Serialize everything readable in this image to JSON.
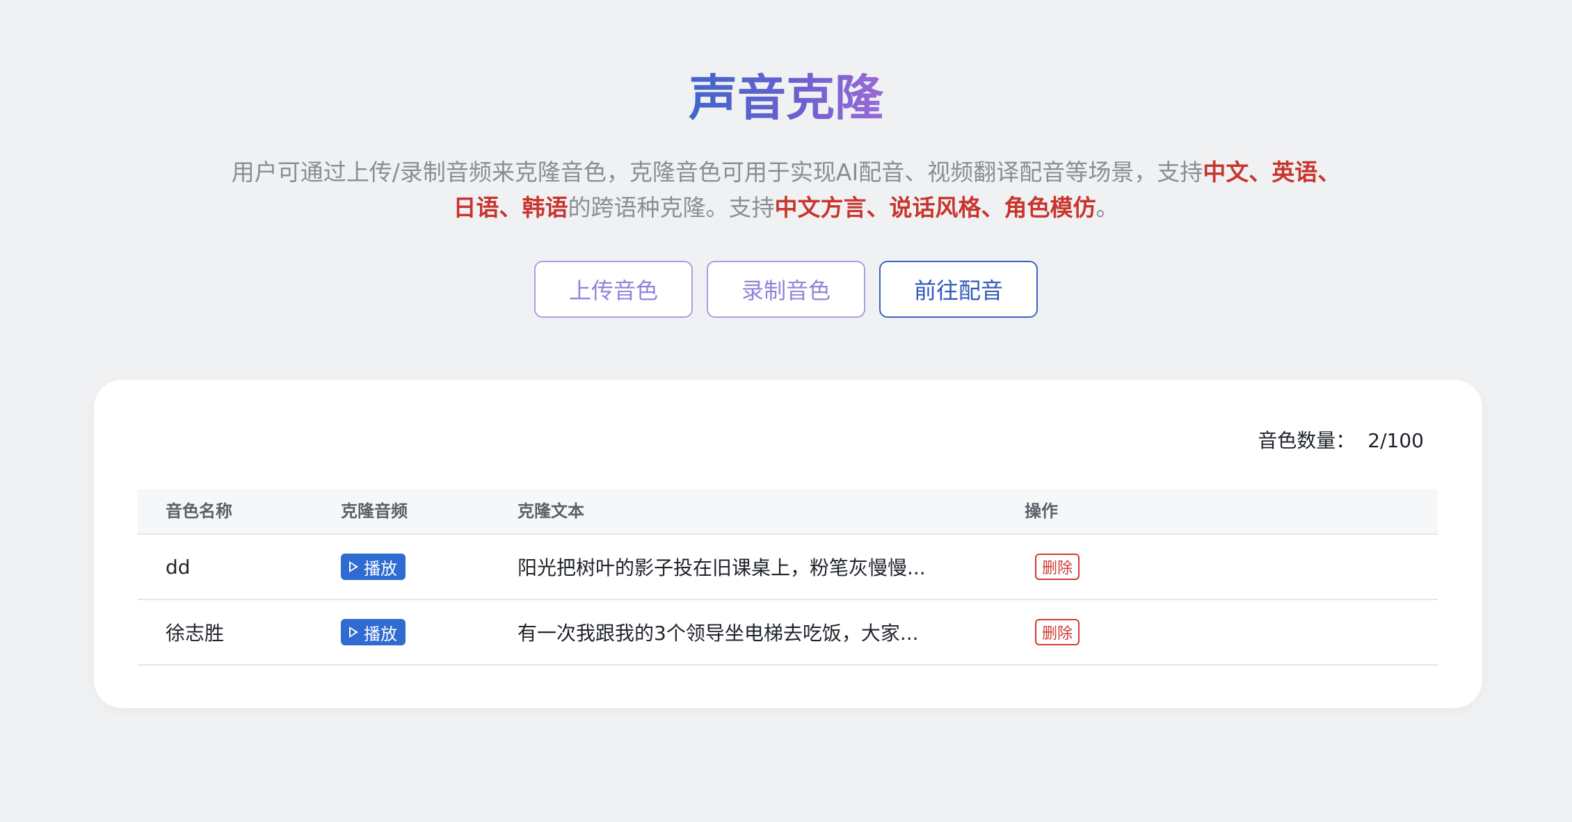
{
  "header": {
    "title": "声音克隆",
    "description_parts": [
      {
        "text": "用户可通过上传/录制音频来克隆音色，克隆音色可用于实现AI配音、视频翻译配音等场景，支持",
        "highlight": false
      },
      {
        "text": "中文、英语、日语、韩语",
        "highlight": true
      },
      {
        "text": "的跨语种克隆。支持",
        "highlight": false
      },
      {
        "text": "中文方言、说话风格、角色模仿",
        "highlight": true
      },
      {
        "text": "。",
        "highlight": false
      }
    ]
  },
  "actions": {
    "upload_label": "上传音色",
    "record_label": "录制音色",
    "dub_label": "前往配音"
  },
  "voice_list": {
    "count_label": "音色数量：",
    "count_value": "2/100",
    "columns": [
      "音色名称",
      "克隆音频",
      "克隆文本",
      "操作"
    ],
    "rows": [
      {
        "name": "dd",
        "play_label": "播放",
        "text": "阳光把树叶的影子投在旧课桌上，粉笔灰慢慢...",
        "delete_label": "删除"
      },
      {
        "name": "徐志胜",
        "play_label": "播放",
        "text": "有一次我跟我的3个领导坐电梯去吃饭，大家...",
        "delete_label": "删除"
      }
    ]
  },
  "colors": {
    "title_gradient_start": "#3f67c9",
    "title_gradient_end": "#9a6bd8",
    "highlight": "#c8352e",
    "play_button": "#2f6bd0",
    "delete": "#cf3b33",
    "primary_outline": "#3d62be",
    "secondary_outline": "#a99ee3"
  },
  "icons": {
    "play": "play-triangle-icon"
  }
}
